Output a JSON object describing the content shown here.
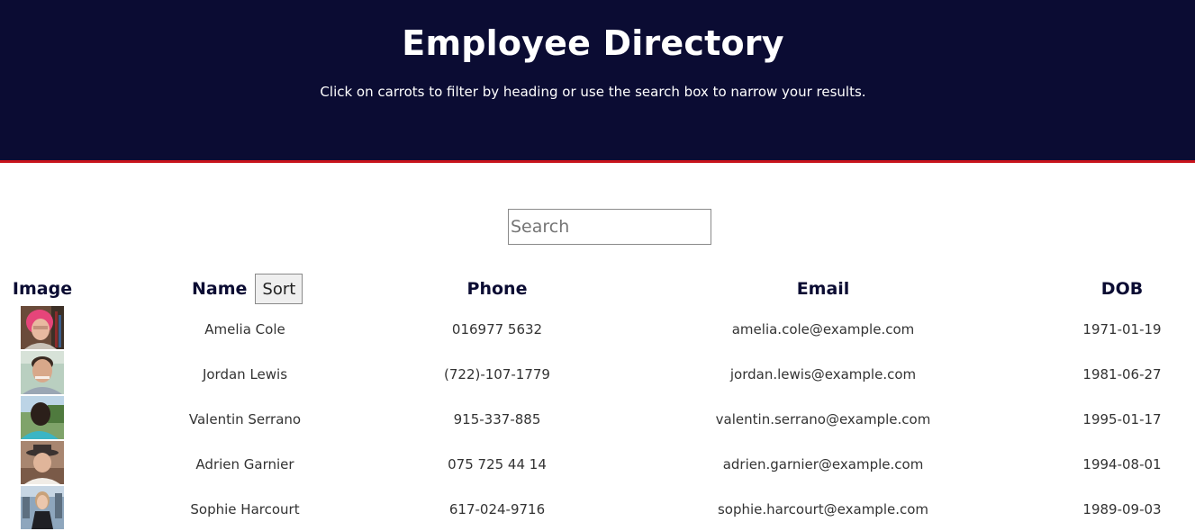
{
  "header": {
    "title": "Employee Directory",
    "subtitle": "Click on carrots to filter by heading or use the search box to narrow your results.",
    "background": "#0b0c33",
    "accent": "#c8141c"
  },
  "search": {
    "placeholder": "Search",
    "value": ""
  },
  "table": {
    "columns": {
      "image": "Image",
      "name": "Name",
      "sort": "Sort",
      "phone": "Phone",
      "email": "Email",
      "dob": "DOB"
    },
    "rows": [
      {
        "name": "Amelia Cole",
        "phone": "016977 5632",
        "email": "amelia.cole@example.com",
        "dob": "1971-01-19",
        "avatar": "portrait-woman-pink-hair"
      },
      {
        "name": "Jordan Lewis",
        "phone": "(722)-107-1779",
        "email": "jordan.lewis@example.com",
        "dob": "1981-06-27",
        "avatar": "portrait-man-smiling"
      },
      {
        "name": "Valentin Serrano",
        "phone": "915-337-885",
        "email": "valentin.serrano@example.com",
        "dob": "1995-01-17",
        "avatar": "portrait-man-outdoors"
      },
      {
        "name": "Adrien Garnier",
        "phone": "075 725 44 14",
        "email": "adrien.garnier@example.com",
        "dob": "1994-08-01",
        "avatar": "portrait-man-hat"
      },
      {
        "name": "Sophie Harcourt",
        "phone": "617-024-9716",
        "email": "sophie.harcourt@example.com",
        "dob": "1989-09-03",
        "avatar": "portrait-woman-city"
      }
    ]
  }
}
